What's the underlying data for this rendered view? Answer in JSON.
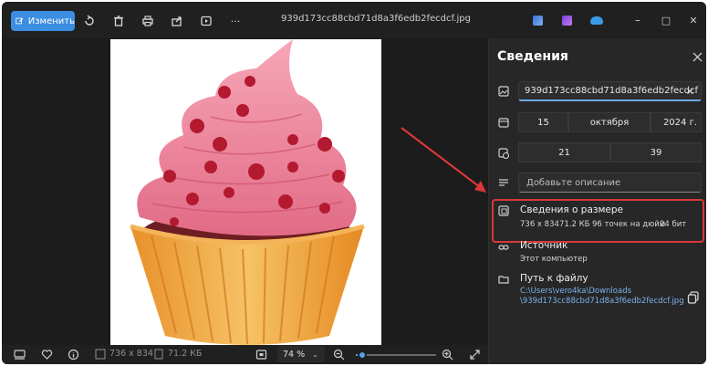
{
  "toolbar": {
    "edit_label": "Изменить",
    "file_title": "939d173cc88cbd71d8a3f6edb2fecdcf.jpg",
    "icons": [
      "edit-icon",
      "rotate-icon",
      "delete-icon",
      "print-icon",
      "share-icon",
      "slideshow-icon",
      "more-icon"
    ],
    "more_label": "···"
  },
  "window_controls": {
    "minimize": "–",
    "maximize": "□",
    "close": "✕"
  },
  "panel": {
    "title": "Сведения",
    "file_name": "939d173cc88cbd71d8a3f6edb2fecdcf",
    "date": {
      "day": "15",
      "month": "октября",
      "year": "2024 г."
    },
    "time": {
      "hour": "21",
      "minute": "39"
    },
    "description_placeholder": "Добавьте описание",
    "size_section": {
      "title": "Сведения о размере",
      "dimensions": "736 x 834",
      "file_size": "71.2 КБ",
      "dpi": "96 точек на дюйм",
      "bit_depth": "24 бит"
    },
    "source_section": {
      "title": "Источник",
      "value": "Этот компьютер"
    },
    "path_section": {
      "title": "Путь к файлу",
      "line1": "C:\\Users\\vero4ka\\Downloads",
      "line2": "\\939d173cc88cbd71d8a3f6edb2fecdcf.jpg"
    }
  },
  "bottom": {
    "dimensions": "736 x 834",
    "file_size": "71.2 КБ",
    "zoom": "74 %",
    "zoom_fraction": 0.08
  },
  "colors": {
    "accent": "#3b8ee0",
    "highlight": "#d9373a",
    "link": "#7ab3ef"
  }
}
